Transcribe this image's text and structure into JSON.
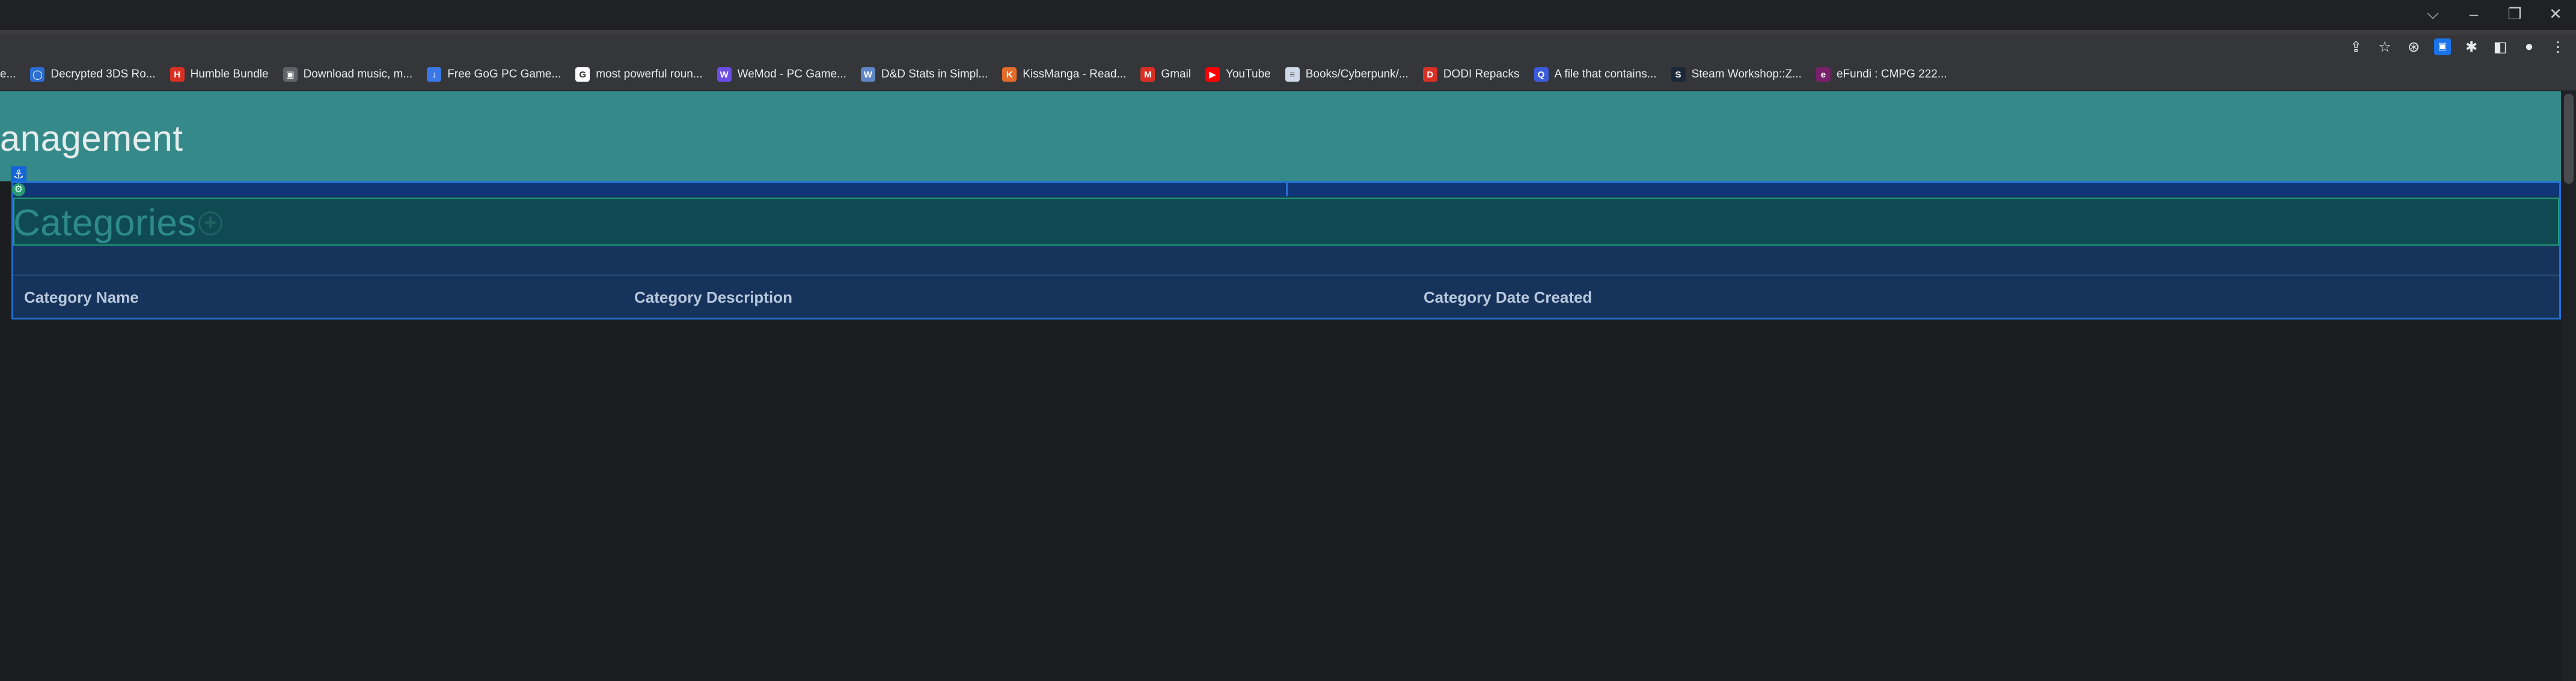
{
  "window": {
    "controls": [
      "⌵",
      "–",
      "❐",
      "✕"
    ]
  },
  "toolbar": {
    "icons": [
      "share-icon",
      "star-icon",
      "extension-icon",
      "extension-icon",
      "puzzle-icon",
      "sidebar-icon",
      "profile-icon",
      "menu-icon"
    ]
  },
  "bookmarks": [
    {
      "label": "e...",
      "color": "#35363a",
      "glyph": ""
    },
    {
      "label": "Decrypted 3DS Ro...",
      "color": "#2c6fd4",
      "glyph": "◯"
    },
    {
      "label": "Humble Bundle",
      "color": "#d93025",
      "glyph": "H"
    },
    {
      "label": "Download music, m...",
      "color": "#5f6368",
      "glyph": "▣"
    },
    {
      "label": "Free GoG PC Game...",
      "color": "#3b78e7",
      "glyph": "↓"
    },
    {
      "label": "most powerful roun...",
      "color": "#ffffff",
      "glyph": "G"
    },
    {
      "label": "WeMod - PC Game...",
      "color": "#6b4de6",
      "glyph": "W"
    },
    {
      "label": "D&D Stats in Simpl...",
      "color": "#5f87c6",
      "glyph": "W"
    },
    {
      "label": "KissManga - Read...",
      "color": "#e36b2c",
      "glyph": "K"
    },
    {
      "label": "Gmail",
      "color": "#d93025",
      "glyph": "M"
    },
    {
      "label": "YouTube",
      "color": "#ff0000",
      "glyph": "▶"
    },
    {
      "label": "Books/Cyberpunk/...",
      "color": "#cfd8e6",
      "glyph": "≡"
    },
    {
      "label": "DODI Repacks",
      "color": "#d93025",
      "glyph": "D"
    },
    {
      "label": "A file that contains...",
      "color": "#3b5bdb",
      "glyph": "Q"
    },
    {
      "label": "Steam Workshop::Z...",
      "color": "#1b2838",
      "glyph": "S"
    },
    {
      "label": "eFundi : CMPG 222...",
      "color": "#7a1f6b",
      "glyph": "e"
    }
  ],
  "page": {
    "title": "Management",
    "title_visible": "lanagement"
  },
  "categories": {
    "title": "Categories",
    "add_icon": "+",
    "columns": [
      "Category Name",
      "Category Description",
      "Category Date Created"
    ]
  },
  "badges": {
    "anchor": "⚓",
    "gear": "⚙"
  }
}
